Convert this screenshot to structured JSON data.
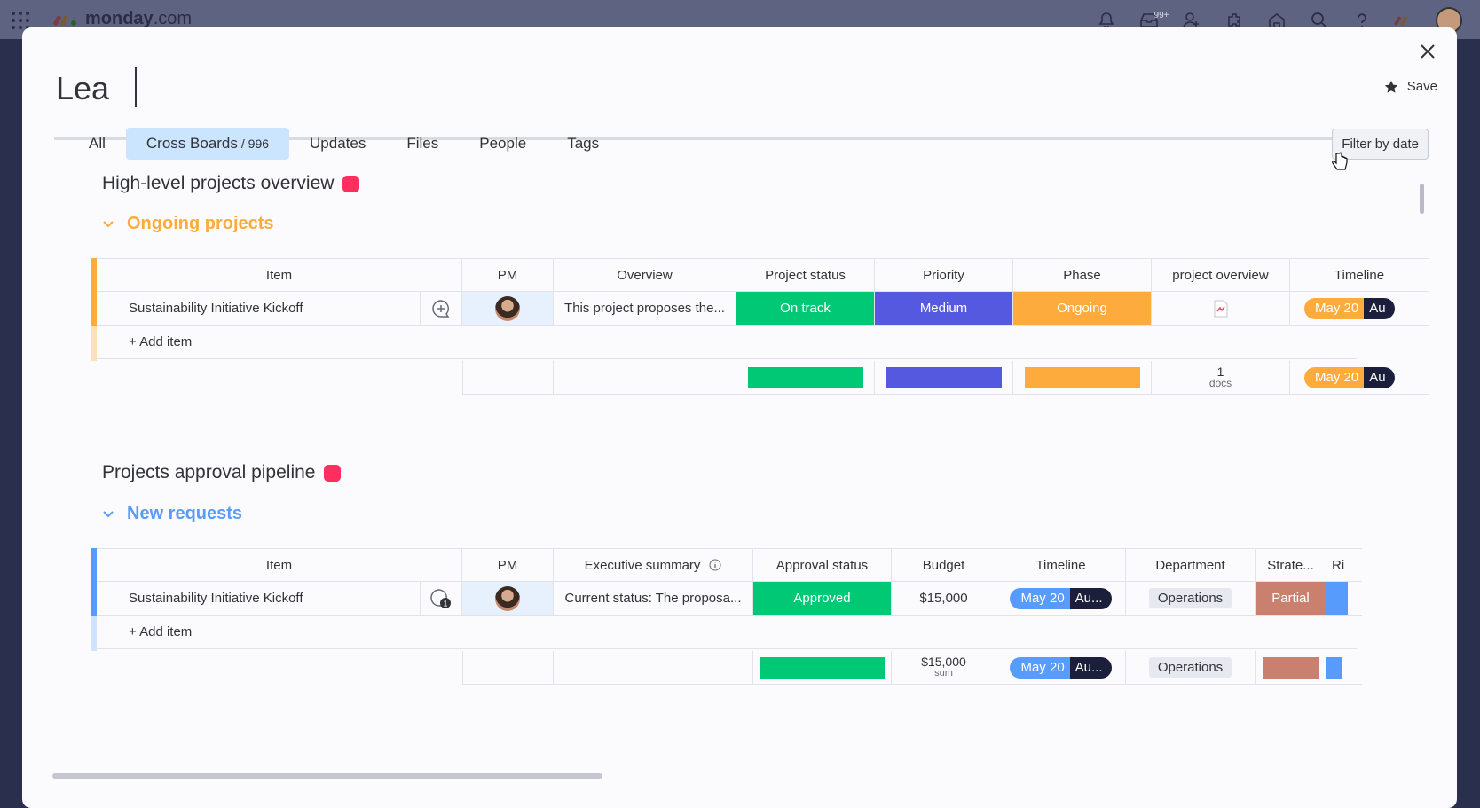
{
  "app": {
    "logo_text": "monday",
    "logo_suffix": ".com",
    "notif_badge": "99+"
  },
  "search": {
    "value": "Lea",
    "placeholder": ""
  },
  "save_label": "Save",
  "tabs": [
    {
      "label": "All"
    },
    {
      "label": "Cross Boards",
      "count": "/ 996"
    },
    {
      "label": "Updates"
    },
    {
      "label": "Files"
    },
    {
      "label": "People"
    },
    {
      "label": "Tags"
    }
  ],
  "filter_label": "Filter by date",
  "board1": {
    "title": "High-level projects overview",
    "group": "Ongoing projects",
    "group_color": "#fdab3d",
    "columns": [
      "Item",
      "PM",
      "Overview",
      "Project status",
      "Priority",
      "Phase",
      "project overview",
      "Timeline"
    ],
    "row": {
      "item": "Sustainability Initiative Kickoff",
      "overview": "This project proposes the...",
      "status": "On track",
      "priority": "Medium",
      "phase": "Ongoing",
      "timeline_start": "May 20",
      "timeline_end": "Au"
    },
    "add_item": "+ Add item",
    "summary": {
      "docs_count": "1",
      "docs_label": "docs",
      "timeline_start": "May 20",
      "timeline_end": "Au"
    }
  },
  "board2": {
    "title": "Projects approval pipeline",
    "group": "New requests",
    "group_color": "#579bfc",
    "columns": [
      "Item",
      "PM",
      "Executive summary",
      "Approval status",
      "Budget",
      "Timeline",
      "Department",
      "Strate...",
      "Ri"
    ],
    "row": {
      "item": "Sustainability Initiative Kickoff",
      "summary": "Current status: The proposa...",
      "approval": "Approved",
      "budget": "$15,000",
      "timeline_start": "May 20",
      "timeline_end": "Au...",
      "department": "Operations",
      "strategic": "Partial",
      "update_count": "1"
    },
    "add_item": "+ Add item",
    "summary": {
      "budget": "$15,000",
      "budget_label": "sum",
      "timeline_start": "May 20",
      "timeline_end": "Au...",
      "department": "Operations"
    }
  },
  "colors": {
    "green": "#00c875",
    "blue": "#5559df",
    "orange": "#fdab3d",
    "salmon": "#c9806f",
    "group_blue": "#579bfc",
    "red_dot": "#ff2e5e"
  }
}
